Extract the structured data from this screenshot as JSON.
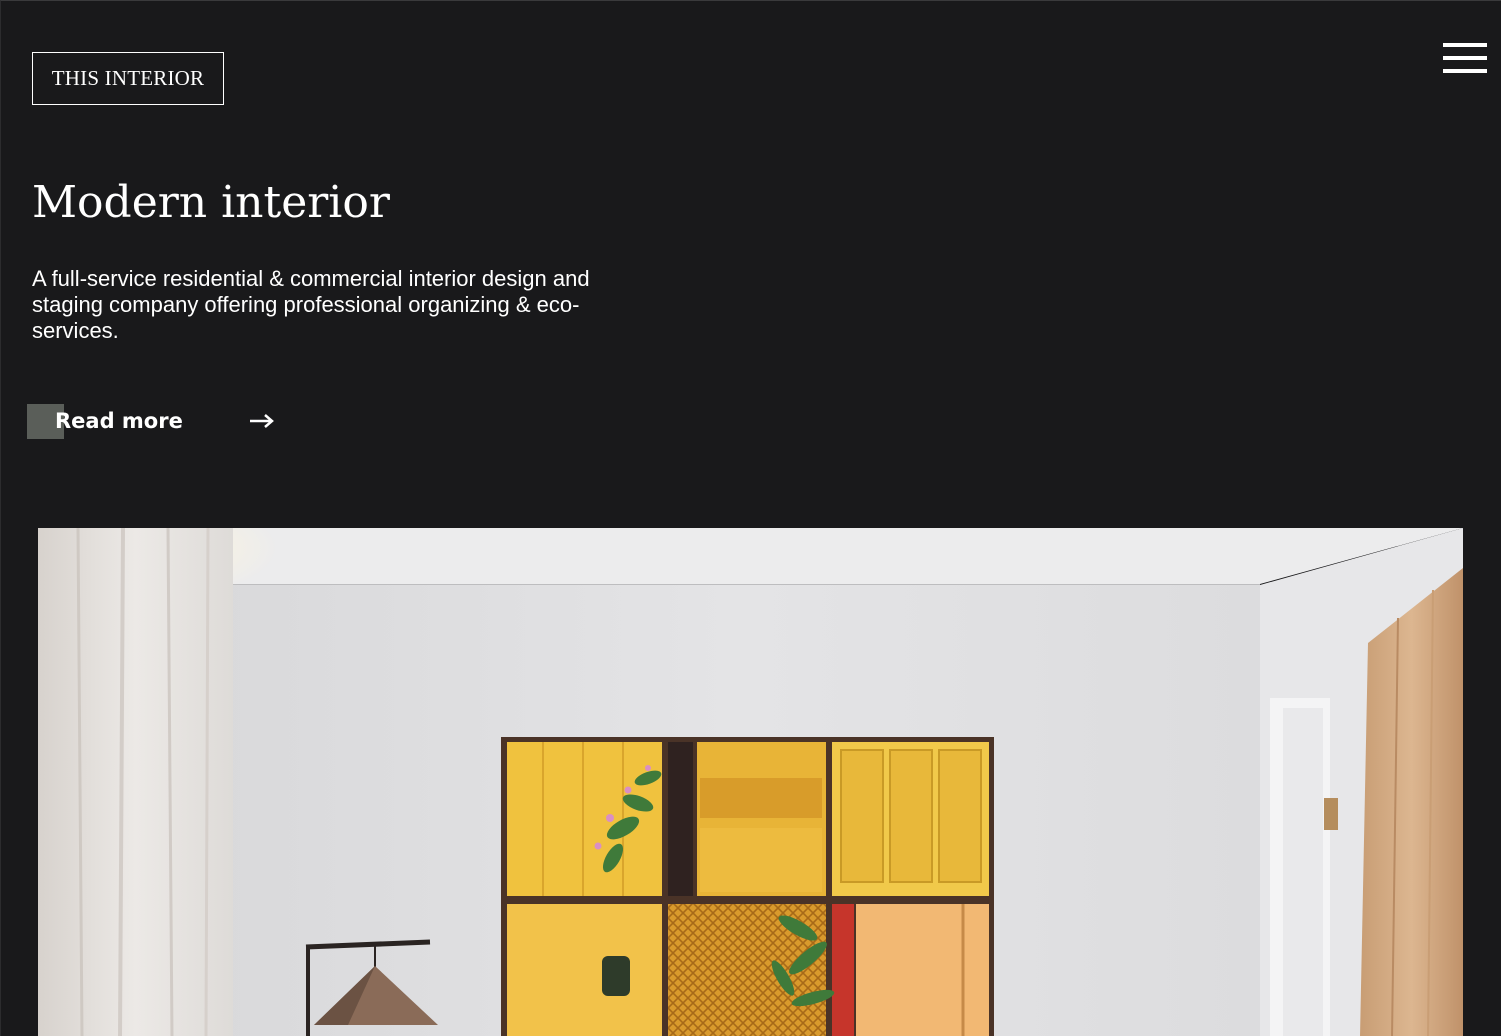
{
  "header": {
    "logo_text": "THIS INTERIOR",
    "menu_icon": "hamburger-menu-icon"
  },
  "hero": {
    "title": "Modern interior",
    "description": "A full-service residential & commercial interior design and staging company offering professional organizing & eco-services.",
    "cta_label": "Read more",
    "cta_icon": "arrow-right-icon"
  },
  "colors": {
    "background": "#19191b",
    "text": "#ffffff",
    "cta_accent": "#5a5e59"
  }
}
